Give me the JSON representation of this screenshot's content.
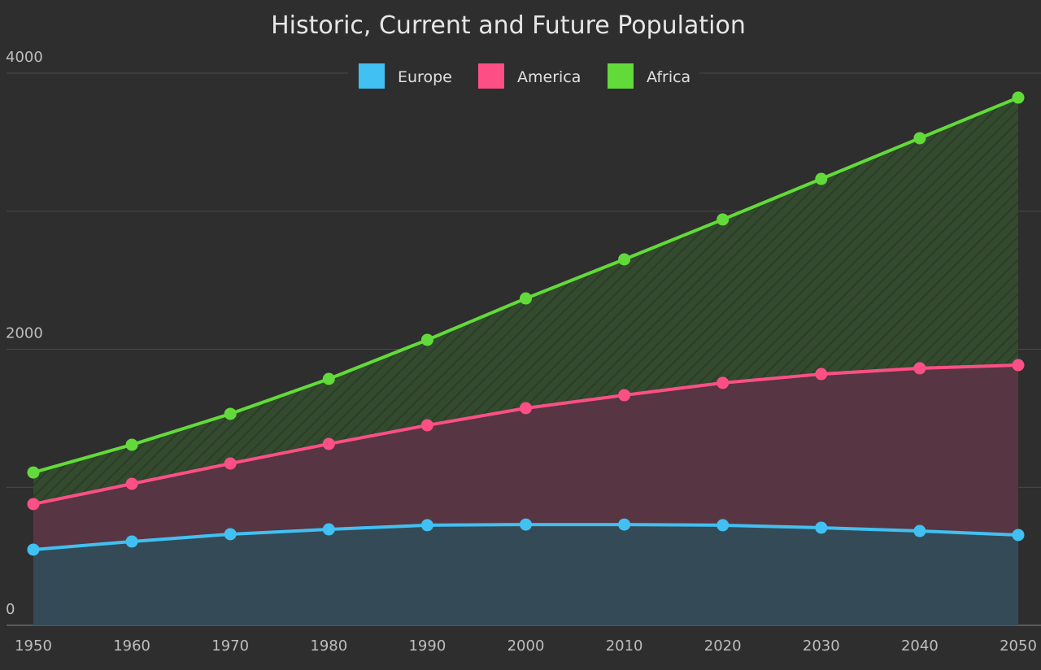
{
  "chart_data": {
    "type": "area",
    "stacked": true,
    "title": "Historic, Current and Future Population",
    "xlabel": "",
    "ylabel": "",
    "x": [
      1950,
      1960,
      1970,
      1980,
      1990,
      2000,
      2010,
      2020,
      2030,
      2040,
      2050
    ],
    "x_tick_labels": [
      "1950",
      "1960",
      "1970",
      "1980",
      "1990",
      "2000",
      "2010",
      "2020",
      "2030",
      "2040",
      "2050"
    ],
    "ylim": [
      0,
      4000
    ],
    "y_ticks": [
      0,
      1000,
      2000,
      3000,
      4000
    ],
    "y_tick_labels": [
      "0",
      "",
      "2000",
      "",
      "4000"
    ],
    "grid": true,
    "legend_position": "top-center",
    "series": [
      {
        "name": "Europe",
        "color": "#41c0f2",
        "fill": "#344b57",
        "values": [
          548,
          607,
          660,
          695,
          725,
          730,
          730,
          725,
          707,
          683,
          654
        ]
      },
      {
        "name": "America",
        "color": "#fc4f85",
        "fill": "#573542",
        "values": [
          330,
          418,
          512,
          619,
          724,
          843,
          937,
          1031,
          1113,
          1179,
          1231
        ]
      },
      {
        "name": "Africa",
        "color": "#62db3a",
        "fill": "#334a2f",
        "hatched": true,
        "values": [
          229,
          283,
          360,
          471,
          619,
          795,
          984,
          1184,
          1414,
          1667,
          1938
        ]
      }
    ]
  },
  "legend": {
    "items": [
      {
        "label": "Europe",
        "color": "#41c0f2"
      },
      {
        "label": "America",
        "color": "#fc4f85"
      },
      {
        "label": "Africa",
        "color": "#62db3a"
      }
    ]
  }
}
